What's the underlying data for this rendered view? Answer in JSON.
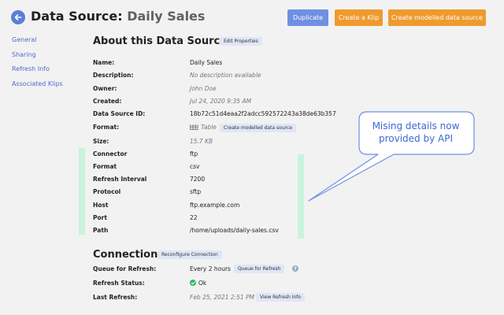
{
  "header": {
    "title_prefix": "Data Source:",
    "title_name": "Daily Sales",
    "buttons": {
      "duplicate": "Duplicate",
      "create_klip": "Create a Klip",
      "create_model": "Create modelled data source"
    }
  },
  "sidebar": {
    "items": [
      {
        "label": "General"
      },
      {
        "label": "Sharing"
      },
      {
        "label": "Refresh Info"
      },
      {
        "label": "Associated Klips"
      }
    ]
  },
  "about": {
    "title": "About this Data Source",
    "edit_label": "Edit Properties",
    "fields": {
      "name": {
        "label": "Name:",
        "value": "Daily Sales"
      },
      "description": {
        "label": "Description:",
        "value": "No description available"
      },
      "owner": {
        "label": "Owner:",
        "value": "John Doe"
      },
      "created": {
        "label": "Created:",
        "value": "Jul 24, 2020 9:35 AM"
      },
      "id": {
        "label": "Data Source ID:",
        "value": "18b72c51d4eaa2f2adcc592572243a38de63b357"
      },
      "format": {
        "label": "Format:",
        "value": "Table",
        "button": "Create modelled data source"
      },
      "size": {
        "label": "Size:",
        "value": "15.7 KB"
      },
      "connector": {
        "label": "Connector",
        "value": "ftp"
      },
      "fmt": {
        "label": "Format",
        "value": "csv"
      },
      "refresh_interval": {
        "label": "Refresh Interval",
        "value": "7200"
      },
      "protocol": {
        "label": "Protocol",
        "value": "sftp"
      },
      "host": {
        "label": "Host",
        "value": "ftp.example.com"
      },
      "port": {
        "label": "Port",
        "value": "22"
      },
      "path": {
        "label": "Path",
        "value": "/home/uploads/daily-sales.csv"
      }
    }
  },
  "connection": {
    "title": "Connection",
    "reconfigure_label": "Reconfigure Connection",
    "queue": {
      "label": "Queue for Refresh:",
      "value": "Every 2 hours",
      "button": "Queue for Refresh",
      "help": "?"
    },
    "status": {
      "label": "Refresh Status:",
      "value": "Ok"
    },
    "last": {
      "label": "Last Refresh:",
      "value": "Feb 25, 2021 2:51 PM",
      "button": "View Refresh Info"
    }
  },
  "callout": {
    "text": "Mising details now provided by API"
  },
  "colors": {
    "accent_blue": "#6f8fe3",
    "accent_orange": "#ef9a2e",
    "highlight_green": "#c9f3dc",
    "callout_blue": "#3d68d4"
  }
}
